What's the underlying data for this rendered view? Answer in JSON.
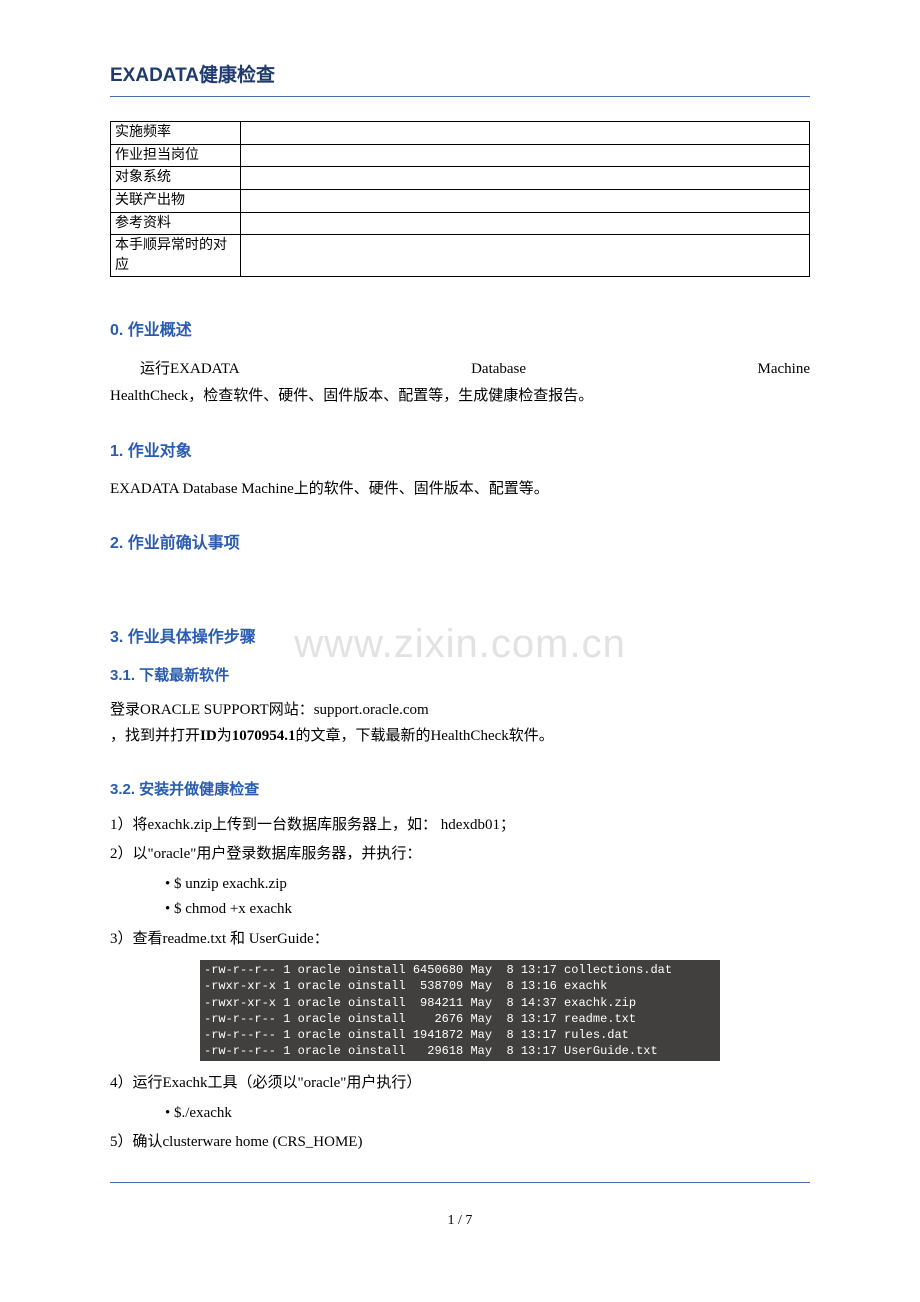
{
  "title": "EXADATA健康检查",
  "watermark": "www.zixin.com.cn",
  "metaRows": [
    "实施频率",
    "作业担当岗位",
    "对象系统",
    "关联产出物",
    "参考资料",
    "本手顺异常时的对应"
  ],
  "s0": {
    "heading": "0. 作业概述",
    "line1a": "运行EXADATA",
    "line1b": "Database",
    "line1c": "Machine",
    "line2": "HealthCheck，检查软件、硬件、固件版本、配置等，生成健康检查报告。"
  },
  "s1": {
    "heading": "1. 作业对象",
    "body": "EXADATA Database Machine上的软件、硬件、固件版本、配置等。"
  },
  "s2": {
    "heading": "2. 作业前确认事项"
  },
  "s3": {
    "heading": "3. 作业具体操作步骤"
  },
  "s31": {
    "heading": "3.1. 下载最新软件",
    "body_a": "登录ORACLE SUPPORT网站：support.oracle.com",
    "body_b": "，找到并打开",
    "body_c": "ID",
    "body_d": "为",
    "body_e": "1070954.1",
    "body_f": "的文章，下载最新的HealthCheck软件。"
  },
  "s32": {
    "heading": "3.2. 安装并做健康检查",
    "step1": "1）将exachk.zip上传到一台数据库服务器上，如： hdexdb01；",
    "step2": "2）以\"oracle\"用户登录数据库服务器，并执行：",
    "step2_b1": "• $ unzip exachk.zip",
    "step2_b2": "• $ chmod +x exachk",
    "step3": "3）查看readme.txt 和 UserGuide：",
    "terminal": "-rw-r--r-- 1 oracle oinstall 6450680 May  8 13:17 collections.dat\n-rwxr-xr-x 1 oracle oinstall  538709 May  8 13:16 exachk\n-rwxr-xr-x 1 oracle oinstall  984211 May  8 14:37 exachk.zip\n-rw-r--r-- 1 oracle oinstall    2676 May  8 13:17 readme.txt\n-rw-r--r-- 1 oracle oinstall 1941872 May  8 13:17 rules.dat\n-rw-r--r-- 1 oracle oinstall   29618 May  8 13:17 UserGuide.txt",
    "step4": "4）运行Exachk工具（必须以\"oracle\"用户执行）",
    "step4_b1": "• $./exachk",
    "step5": "5）确认clusterware home (CRS_HOME)"
  },
  "pageNum": "1 / 7"
}
